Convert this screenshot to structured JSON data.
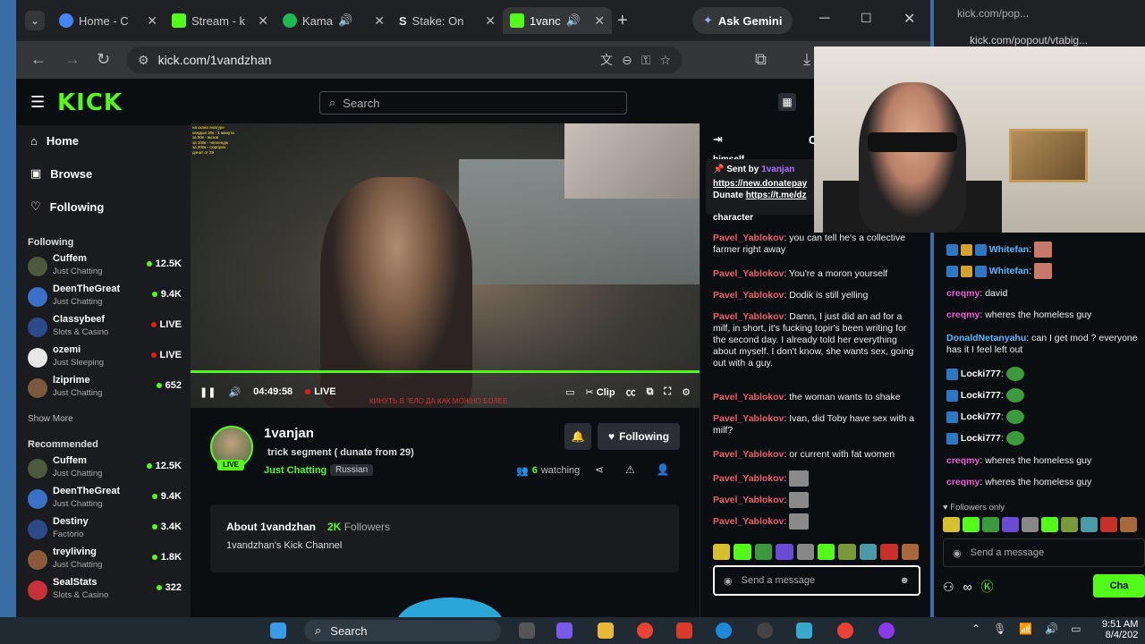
{
  "browser": {
    "tabs": [
      {
        "label": "Home - C",
        "color": "#4285f4"
      },
      {
        "label": "Stream - k",
        "color": "#53fc18"
      },
      {
        "label": "Kama",
        "color": "#1db954"
      },
      {
        "label": "Stake: On",
        "color": "#e8e8e8"
      },
      {
        "label": "1vanc",
        "color": "#53fc18"
      }
    ],
    "new_tab": "+",
    "gemini": "Ask Gemini",
    "url": "kick.com/1vandzhan"
  },
  "kick": {
    "logo": "KICK",
    "search_placeholder": "Search",
    "nav": [
      {
        "label": "Home",
        "icon": "home-icon"
      },
      {
        "label": "Browse",
        "icon": "browse-icon"
      },
      {
        "label": "Following",
        "icon": "heart-icon"
      }
    ],
    "following_title": "Following",
    "following": [
      {
        "name": "Cuffem",
        "cat": "Just Chatting",
        "viewers": "12.5K",
        "live": false,
        "color": "#4a5a3a"
      },
      {
        "name": "DeenTheGreat",
        "cat": "Just Chatting",
        "viewers": "9.4K",
        "live": false,
        "color": "#3a70c8"
      },
      {
        "name": "Classybeef",
        "cat": "Slots & Casino",
        "viewers": "LIVE",
        "live": true,
        "color": "#2a4a8a"
      },
      {
        "name": "ozemi",
        "cat": "Just Sleeping",
        "viewers": "LIVE",
        "live": true,
        "color": "#e8e8e8"
      },
      {
        "name": "lziprime",
        "cat": "Just Chatting",
        "viewers": "652",
        "live": false,
        "color": "#7a5a3a"
      }
    ],
    "show_more": "Show More",
    "recommended_title": "Recommended",
    "recommended": [
      {
        "name": "Cuffem",
        "cat": "Just Chatting",
        "viewers": "12.5K",
        "color": "#4a5a3a"
      },
      {
        "name": "DeenTheGreat",
        "cat": "Just Chatting",
        "viewers": "9.4K",
        "color": "#3a70c8"
      },
      {
        "name": "Destiny",
        "cat": "Factorio",
        "viewers": "3.4K",
        "color": "#2a4a8a"
      },
      {
        "name": "treyliving",
        "cat": "Just Chatting",
        "viewers": "1.8K",
        "color": "#8a5a3a"
      },
      {
        "name": "SealStats",
        "cat": "Slots & Casino",
        "viewers": "322",
        "color": "#c8303a"
      }
    ],
    "player": {
      "time": "04:49:58",
      "live": "LIVE",
      "clip": "Clip",
      "ticker": "КИНУТЬ В \"ЕЛО ДА КАК МОЖНО БОЛЕЕ",
      "overlay_lines": [
        "на кхана янатуре",
        "каждые 30к - 1 минута",
        "за 50к - вызов",
        "за 100к - челлендж",
        "за 200к - сюрприз",
        "донат от 29"
      ]
    },
    "channel": {
      "name": "1vanjan",
      "title": "trick segment ( dunate from 29)",
      "category": "Just Chatting",
      "tag": "Russian",
      "live_badge": "LIVE",
      "follow_label": "Following",
      "watching_count": "6",
      "watching_label": "watching",
      "about_title": "About 1vandzhan",
      "followers_count": "2K",
      "followers_label": "Followers",
      "about_desc": "1vandzhan's Kick Channel"
    },
    "chat": {
      "title": "Ch",
      "partial_top": "himself",
      "pinned_sent_by": "Sent by",
      "pinned_user": "1vanjan",
      "pinned_link1": "https://new.donatepay",
      "pinned_dunate": "Dunate",
      "pinned_link2": "https://t.me/dz",
      "partial_char": "character",
      "messages": [
        {
          "user": "Pavel_Yablokov",
          "text": "you can tell he's a collective farmer right away"
        },
        {
          "user": "Pavel_Yablokov",
          "text": "You're a moron yourself"
        },
        {
          "user": "Pavel_Yablokov",
          "text": "Dodik is still yelling"
        },
        {
          "user": "Pavel_Yablokov",
          "text": "Damn, I just did an ad for a milf, in short, it's fucking topir's been writing for the second day. I already told her everything about myself. I don't know, she wants sex, going out with a guy."
        },
        {
          "user": "Pavel_Yablokov",
          "text": "the woman wants to shake"
        },
        {
          "user": "Pavel_Yablokov",
          "text": "Ivan, did Toby have sex with a milf?"
        },
        {
          "user": "Pavel_Yablokov",
          "text": "or current with fat women"
        },
        {
          "user": "Pavel_Yablokov",
          "text": ""
        },
        {
          "user": "Pavel_Yablokov",
          "text": ""
        },
        {
          "user": "Pavel_Yablokov",
          "text": ""
        }
      ],
      "input_placeholder": "Send a message"
    }
  },
  "popout": {
    "title": "kick.com/pop...",
    "url": "kick.com/popout/vtabig...",
    "messages": [
      {
        "user": "Whitefan",
        "text": "",
        "color": "#53b9ff",
        "badges": true
      },
      {
        "user": "Whitefan",
        "text": "",
        "color": "#53b9ff",
        "badges": true
      },
      {
        "user": "creqmy",
        "text": "david",
        "color": "#ec5cd5"
      },
      {
        "user": "creqmy",
        "text": "wheres the homeless guy",
        "color": "#ec5cd5"
      },
      {
        "user": "DonaldNetanyahu",
        "text": "can I get mod ? everyone has it I feel left out",
        "color": "#53b9ff"
      },
      {
        "user": "Locki777",
        "text": "",
        "color": "#fff",
        "frog": true
      },
      {
        "user": "Locki777",
        "text": "",
        "color": "#fff",
        "frog": true
      },
      {
        "user": "Locki777",
        "text": "",
        "color": "#fff",
        "frog": true
      },
      {
        "user": "Locki777",
        "text": "",
        "color": "#fff",
        "frog": true
      },
      {
        "user": "creqmy",
        "text": "wheres the homeless guy",
        "color": "#ec5cd5"
      },
      {
        "user": "creqmy",
        "text": "wheres the homeless guy",
        "color": "#ec5cd5"
      }
    ],
    "followers_only": "Followers only",
    "input_placeholder": "Send a message",
    "chat_button": "Cha"
  },
  "taskbar": {
    "search": "Search",
    "time": "9:51 AM",
    "date": "8/4/202"
  }
}
